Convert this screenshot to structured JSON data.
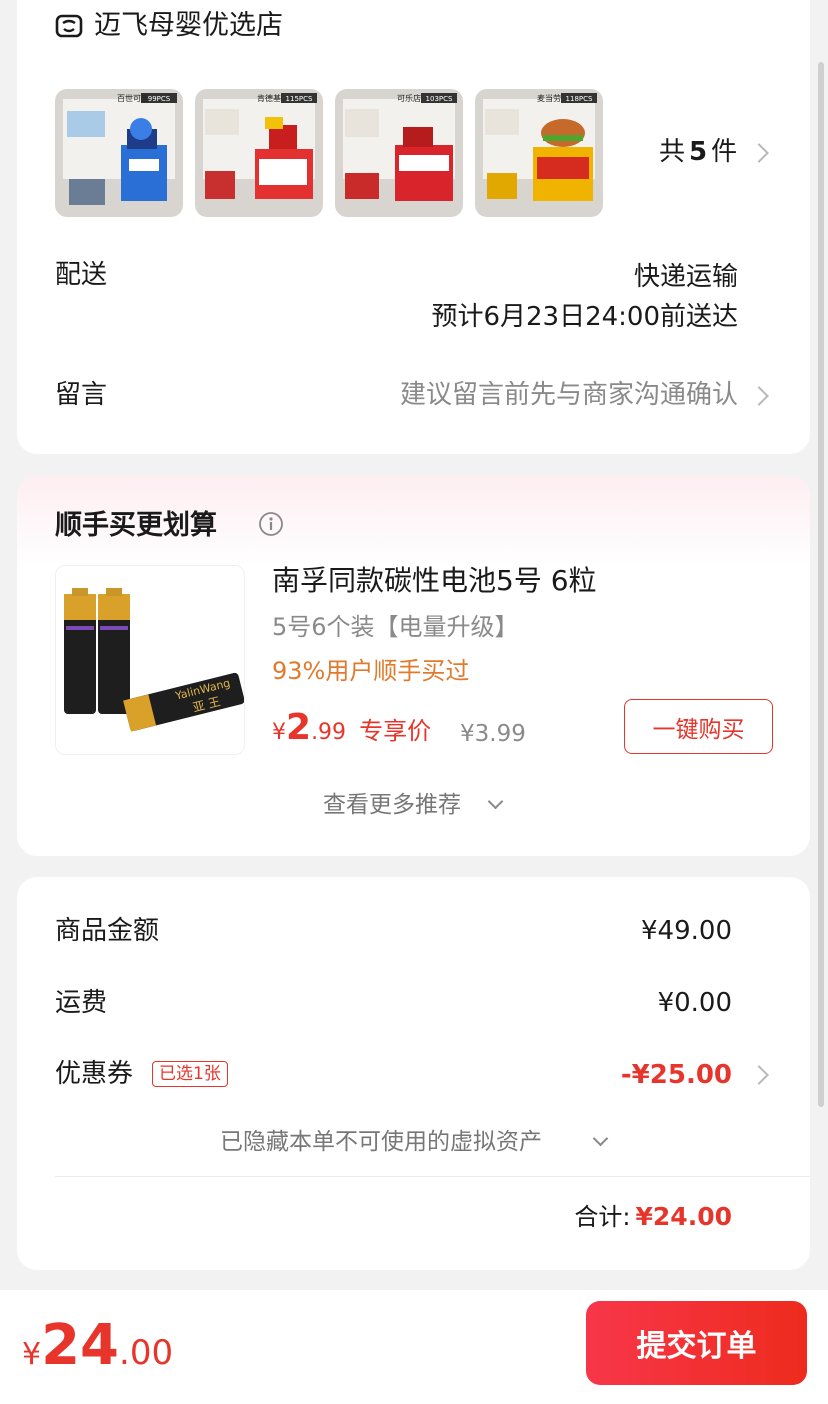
{
  "shop": {
    "name": "迈飞母婴优选店",
    "items_count_text": "共",
    "items_count_num": "5",
    "items_count_unit": "件",
    "thumbnails": [
      {
        "brand": "百世可乐",
        "pcs": "99PCS",
        "color": "#2a6fd6"
      },
      {
        "brand": "肯德基",
        "pcs": "115PCS",
        "color": "#e33131"
      },
      {
        "brand": "可乐店",
        "pcs": "103PCS",
        "color": "#d8242a"
      },
      {
        "brand": "麦当劳",
        "pcs": "118PCS",
        "color": "#f0b400"
      }
    ]
  },
  "delivery": {
    "label": "配送",
    "method": "快递运输",
    "eta": "预计6月23日24:00前送达"
  },
  "message": {
    "label": "留言",
    "placeholder": "建议留言前先与商家沟通确认"
  },
  "recommend": {
    "title": "顺手买更划算",
    "product": {
      "name": "南孚同款碳性电池5号 6粒",
      "spec": "5号6个装【电量升级】",
      "social_proof": "93%用户顺手买过",
      "price_symbol": "¥",
      "price_int": "2",
      "price_dec": ".99",
      "price_tag": "专享价",
      "original_price": "¥3.99",
      "image_brand": "YalinWang",
      "image_brand_cn": "亚 王"
    },
    "buy_button": "一键购买",
    "more": "查看更多推荐"
  },
  "summary": {
    "goods_label": "商品金额",
    "goods_value": "¥49.00",
    "shipping_label": "运费",
    "shipping_value": "¥0.00",
    "coupon_label": "优惠券",
    "coupon_badge": "已选1张",
    "coupon_value": "-¥25.00",
    "hidden_assets": "已隐藏本单不可使用的虚拟资产",
    "total_label": "合计:",
    "total_value": "¥24.00"
  },
  "bottom": {
    "price_symbol": "¥",
    "price_int": "24",
    "price_dec": ".00",
    "submit": "提交订单"
  },
  "colors": {
    "accent_red": "#e8352b",
    "orange": "#e07b2e",
    "submit_gradient": [
      "#f7364a",
      "#ee2b1d"
    ]
  }
}
